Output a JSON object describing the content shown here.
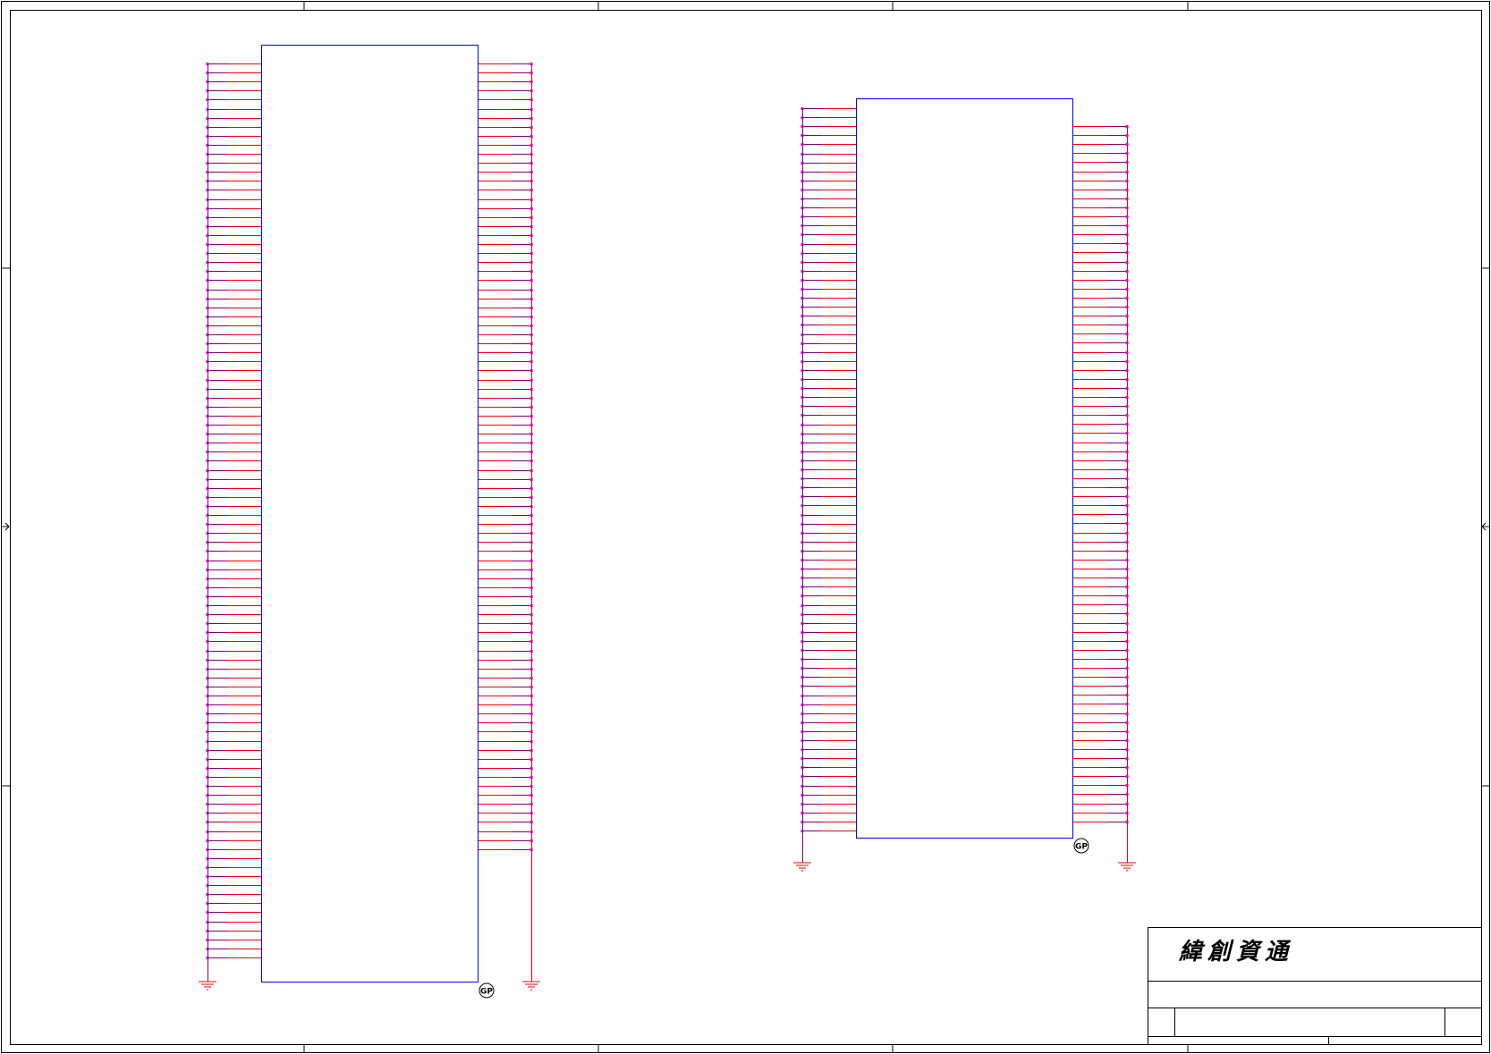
{
  "title_block": {
    "company": "緯創資通"
  },
  "colors": {
    "border": "#000000",
    "component_outline": "#0000ff",
    "pin_wire": "#ff0000",
    "net_wire": "#800080",
    "junction": "#ff00ff",
    "ground_symbol": "#ff0000"
  },
  "components": [
    {
      "id": "connector-1",
      "left_pins": 100,
      "right_pins": 88,
      "ground_label": "GP"
    },
    {
      "id": "connector-2",
      "left_pins": 81,
      "right_pins": 78,
      "ground_label": "GP"
    }
  ]
}
